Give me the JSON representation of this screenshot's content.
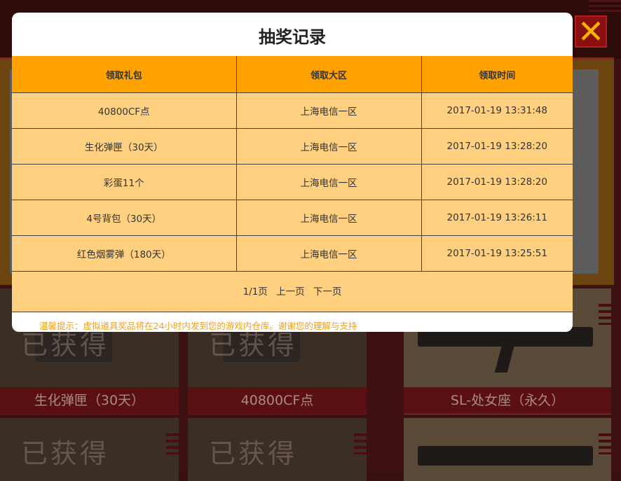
{
  "modal": {
    "title": "抽奖记录",
    "columns": [
      "领取礼包",
      "领取大区",
      "领取时间"
    ],
    "rows": [
      [
        "40800CF点",
        "上海电信一区",
        "2017-01-19 13:31:48"
      ],
      [
        "生化弹匣（30天）",
        "上海电信一区",
        "2017-01-19 13:28:20"
      ],
      [
        "彩蛋11个",
        "上海电信一区",
        "2017-01-19 13:28:20"
      ],
      [
        "4号背包（30天）",
        "上海电信一区",
        "2017-01-19 13:26:11"
      ],
      [
        "红色烟雾弹（180天）",
        "上海电信一区",
        "2017-01-19 13:25:51"
      ]
    ],
    "pager": {
      "page_info": "1/1页",
      "prev_label": "上一页",
      "next_label": "下一页"
    },
    "tip": "温馨提示：虚拟道具奖品将在24小时内发到您的游戏内仓库。谢谢您的理解与支持"
  },
  "background": {
    "cards": [
      {
        "label": "生化弹匣（30天）",
        "overlay": "已获得"
      },
      {
        "label": "40800CF点",
        "overlay": "已获得"
      },
      {
        "label": "SL-处女座（永久）",
        "overlay": ""
      }
    ],
    "lower_cards": [
      {
        "overlay": "已获得"
      },
      {
        "overlay": "已获得"
      },
      {
        "overlay": ""
      }
    ]
  },
  "close_icon": "close-x-icon",
  "colors": {
    "header_bg": "#ffa200",
    "row_bg": "#ffd080",
    "tip_text": "#f0a020",
    "close_x": "#f6b400"
  }
}
